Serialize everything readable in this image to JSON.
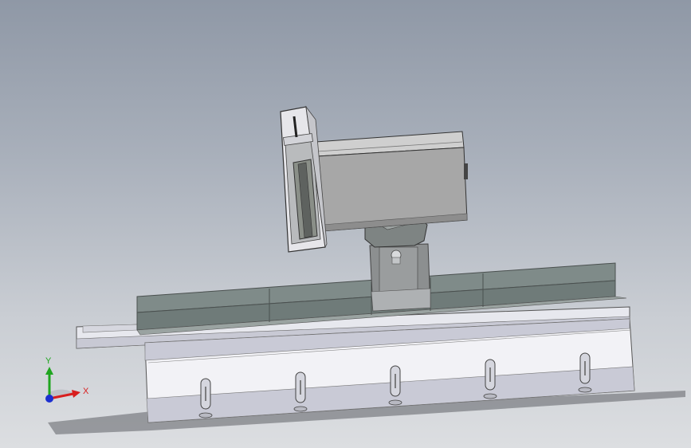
{
  "viewport": {
    "background_top": "#8f98a6",
    "background_bottom": "#dcdee1"
  },
  "triad": {
    "x_label": "X",
    "y_label": "Y",
    "x_color": "#d81e1e",
    "y_color": "#1fa51f",
    "z_color": "#1b2fd0"
  },
  "model": {
    "colors": {
      "frame_light": "#f2f2f6",
      "frame_shade": "#c9cad6",
      "stone": "#7d8a88",
      "housing": "#a7a7a7",
      "housing_light": "#cfcfcf",
      "blade": "#8a8f88",
      "pillar": "#8c8f90"
    },
    "feet_count": 5,
    "stone_segments": 5
  }
}
